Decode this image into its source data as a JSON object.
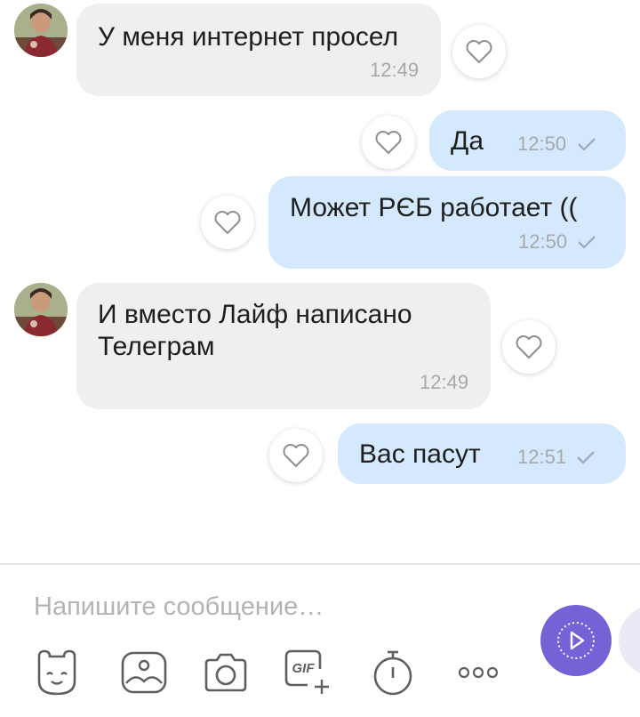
{
  "messages": [
    {
      "direction": "in",
      "text": "У меня интернет просел",
      "time": "12:49"
    },
    {
      "direction": "out",
      "text": "Да",
      "time": "12:50"
    },
    {
      "direction": "out",
      "text": "Может РЄБ работает  ((",
      "time": "12:50"
    },
    {
      "direction": "in",
      "text": "И вместо Лайф написано\nТелеграм",
      "time": "12:49"
    },
    {
      "direction": "out",
      "text": "Вас пасут",
      "time": "12:51"
    }
  ],
  "composer": {
    "placeholder": "Напишите сообщение…",
    "value": ""
  },
  "toolbar": {
    "icons": [
      "sticker-icon",
      "gallery-icon",
      "camera-icon",
      "gif-icon",
      "timer-icon",
      "more-icon"
    ],
    "gif_label": "GIF"
  },
  "colors": {
    "incoming_bubble": "#efefef",
    "outgoing_bubble": "#d4e9fd",
    "accent": "#7462d6",
    "timestamp": "#a6a8ac"
  }
}
